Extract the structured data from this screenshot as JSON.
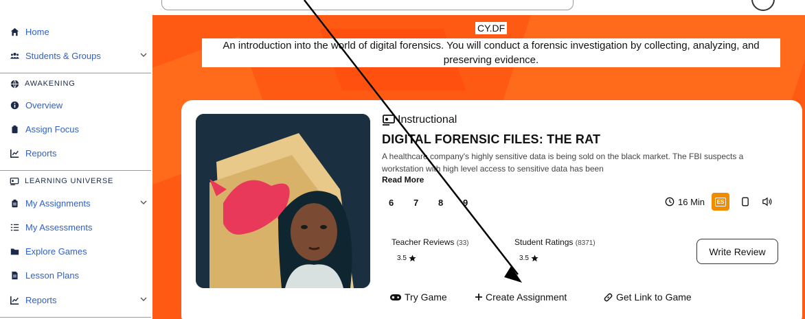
{
  "sidebar": {
    "home": "Home",
    "students": "Students & Groups",
    "section_awakening": "AWAKENING",
    "overview": "Overview",
    "assign_focus": "Assign Focus",
    "reports1": "Reports",
    "section_learning": "LEARNING UNIVERSE",
    "my_assignments": "My Assignments",
    "my_assessments": "My Assessments",
    "explore_games": "Explore Games",
    "lesson_plans": "Lesson Plans",
    "reports2": "Reports"
  },
  "hero": {
    "title": "CY.DF",
    "description": "An introduction into the world of digital forensics. You will conduct a forensic investigation by collecting, analyzing, and preserving evidence."
  },
  "game": {
    "type": "Instructional",
    "title": "DIGITAL FORENSIC FILES: THE RAT",
    "description": "A healthcare company's highly sensitive data is being sold on the black market. The FBI suspects a workstation with high level access to sensitive data has been",
    "read_more": "Read More",
    "grades": [
      "6",
      "7",
      "8",
      "9"
    ],
    "duration": "16 Min",
    "language_badge": "ES",
    "teacher_reviews_label": "Teacher Reviews",
    "teacher_reviews_count": "(33)",
    "teacher_rating": "3.5",
    "student_ratings_label": "Student Ratings",
    "student_ratings_count": "(8371)",
    "student_rating": "3.5",
    "write_review": "Write Review",
    "try_game": "Try Game",
    "create_assignment": "Create Assignment",
    "get_link": "Get Link to Game"
  },
  "colors": {
    "accent_orange": "#ff5a13",
    "nav_link_blue": "#2f5fc9",
    "badge_orange": "#f08c00"
  },
  "icons": [
    "home-icon",
    "users-icon",
    "globe-icon",
    "info-icon",
    "clipboard-icon",
    "chart-icon",
    "book-icon",
    "list-icon",
    "folder-icon",
    "file-icon",
    "clock-icon",
    "phone-icon",
    "speaker-icon",
    "gamepad-icon",
    "plus-icon",
    "link-icon",
    "star-icon"
  ]
}
